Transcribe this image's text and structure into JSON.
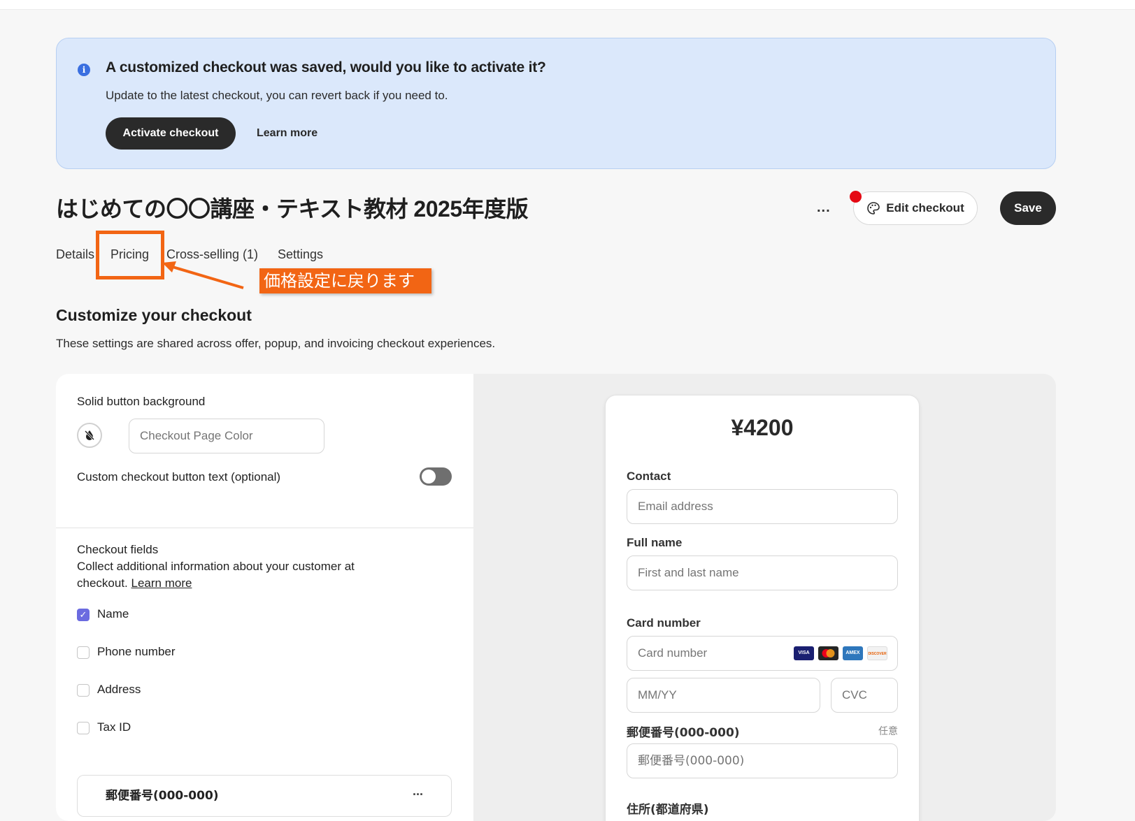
{
  "banner": {
    "title": "A customized checkout was saved, would you like to activate it?",
    "subtitle": "Update to the latest checkout, you can revert back if you need to.",
    "activate_label": "Activate checkout",
    "learn_more_label": "Learn more"
  },
  "header": {
    "title": "はじめての〇〇講座・テキスト教材 2025年度版",
    "more_label": "...",
    "edit_checkout_label": "Edit checkout",
    "save_label": "Save"
  },
  "tabs": [
    {
      "label": "Details"
    },
    {
      "label": "Pricing"
    },
    {
      "label": "Cross-selling (1)"
    },
    {
      "label": "Settings"
    }
  ],
  "annotation": {
    "callout_text": "価格設定に戻ります",
    "color": "#f26514"
  },
  "section": {
    "title": "Customize your checkout",
    "subtitle": "These settings are shared across offer, popup, and invoicing checkout experiences."
  },
  "left_panel": {
    "button_bg_label": "Solid button background",
    "color_input_placeholder": "Checkout Page Color",
    "custom_text_label": "Custom checkout button text (optional)",
    "checkout_fields_title": "Checkout fields",
    "checkout_fields_desc": "Collect additional information about your customer at",
    "checkout_fields_desc2": "checkout.",
    "checkout_fields_link": "Learn more",
    "fields": [
      {
        "label": "Name",
        "checked": true
      },
      {
        "label": "Phone number",
        "checked": false
      },
      {
        "label": "Address",
        "checked": false
      },
      {
        "label": "Tax ID",
        "checked": false
      }
    ],
    "custom_field_label": "郵便番号(000-000)",
    "custom_field_menu": "..."
  },
  "preview": {
    "price": "¥4200",
    "contact_label": "Contact",
    "email_placeholder": "Email address",
    "fullname_label": "Full name",
    "fullname_placeholder": "First and last name",
    "card_label": "Card number",
    "card_placeholder": "Card number",
    "card_brands": [
      "VISA",
      "MC",
      "AMEX",
      "DISCOVER"
    ],
    "expiry_placeholder": "MM/YY",
    "cvc_placeholder": "CVC",
    "postal_label": "郵便番号(000-000)",
    "postal_optional": "任意",
    "postal_placeholder": "郵便番号(000-000)",
    "address_label": "住所(都道府県)"
  }
}
